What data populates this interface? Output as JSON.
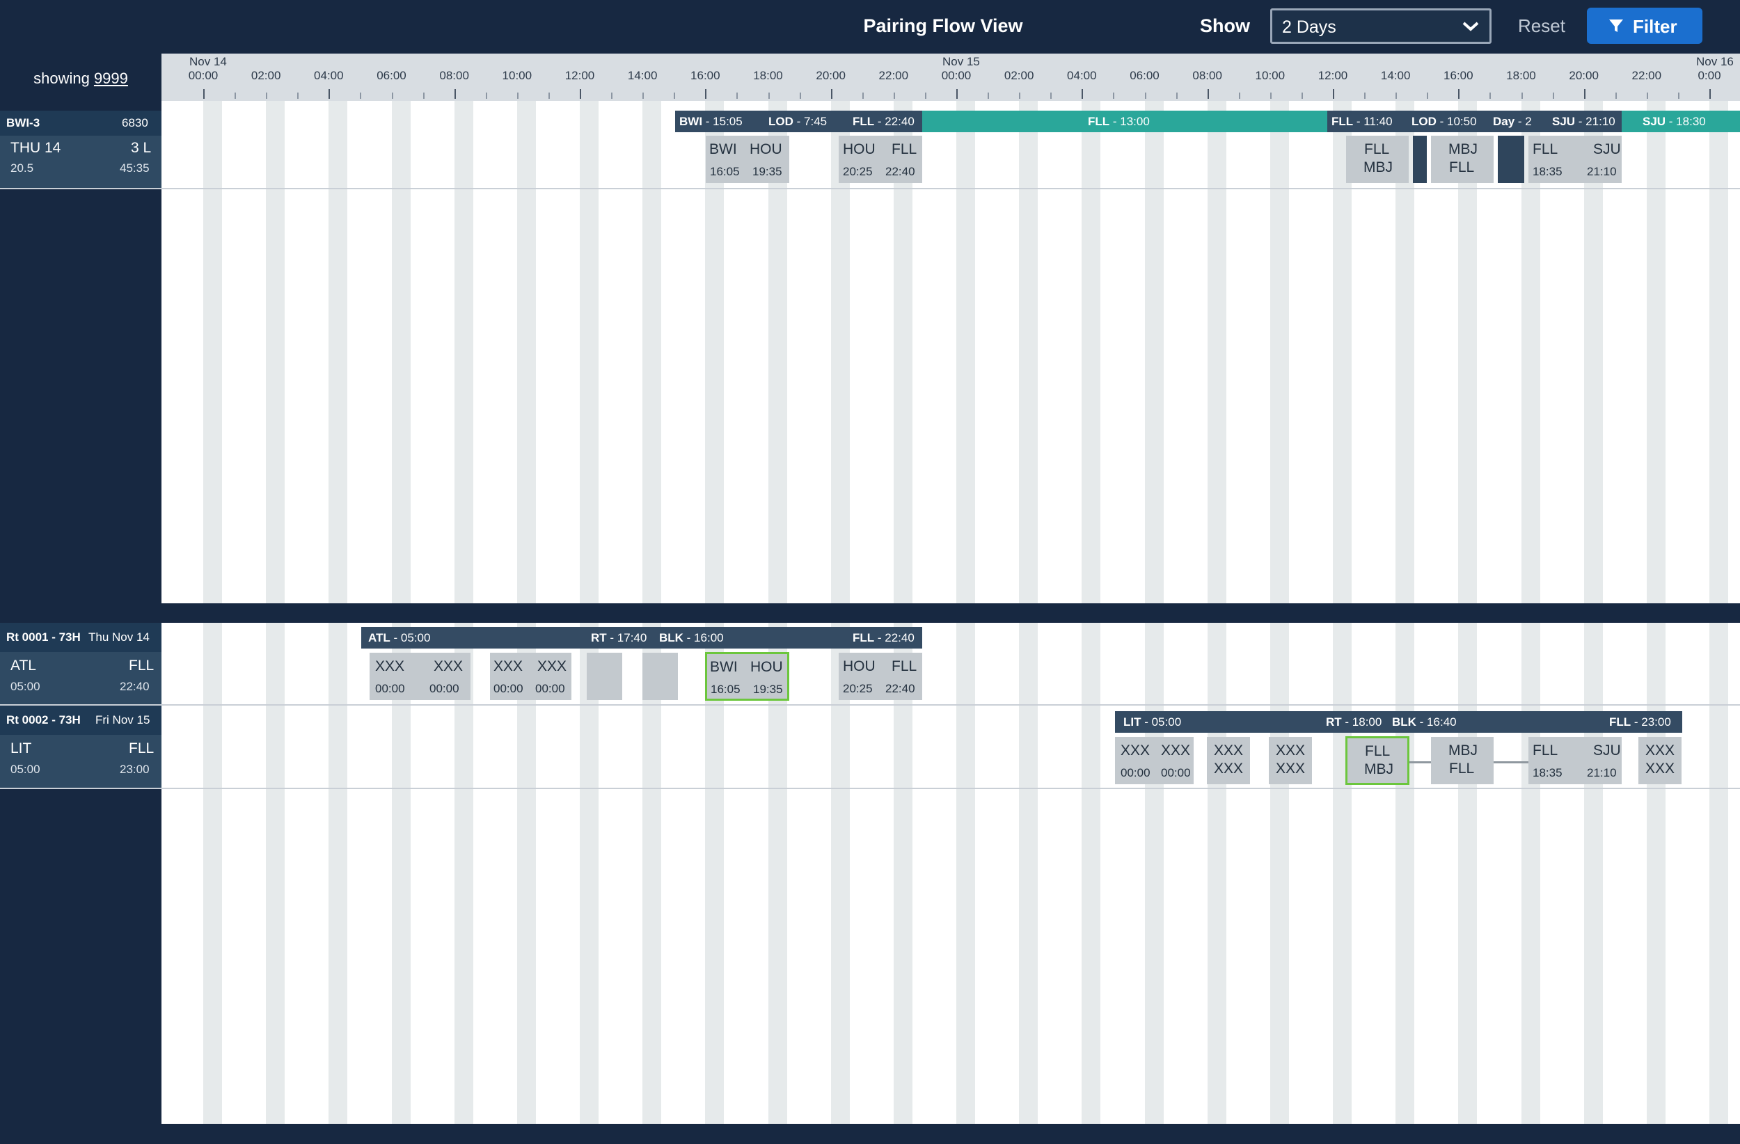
{
  "header": {
    "title": "Pairing Flow View",
    "show_label": "Show",
    "show_select": "2 Days",
    "reset_label": "Reset",
    "filter_label": "Filter"
  },
  "showing": {
    "prefix": "showing",
    "count": "9999"
  },
  "timeline": {
    "dates": [
      "Nov 14",
      "Nov 15",
      "Nov 16"
    ],
    "ticks_day1": [
      "00:00",
      "02:00",
      "04:00",
      "06:00",
      "08:00",
      "10:00",
      "12:00",
      "14:00",
      "16:00",
      "18:00",
      "20:00",
      "22:00"
    ],
    "ticks_day2": [
      "00:00",
      "02:00",
      "04:00",
      "06:00",
      "08:00",
      "10:00",
      "12:00",
      "14:00",
      "16:00",
      "18:00",
      "20:00",
      "22:00"
    ],
    "tick_end": "0:00"
  },
  "pairing": {
    "id": "BWI-3",
    "number": "6830",
    "day": "THU 14",
    "legs": "3 L",
    "credit": "20.5",
    "tafb": "45:35",
    "bar": {
      "bwi": "BWI",
      "bwi_t": " - 15:05",
      "lod": "LOD",
      "lod_t": " - 7:45",
      "fll": "FLL",
      "fll_t": " - 22:40",
      "fll_rest": "FLL",
      "fll_rest_t": " - 13:00",
      "fll2": "FLL",
      "fll2_t": " - 11:40",
      "lod2": "LOD",
      "lod2_t": " - 10:50",
      "day": "Day",
      "day_t": " - 2",
      "sju": "SJU",
      "sju_t": " - 21:10",
      "sju_rest": "SJU",
      "sju_rest_t": " - 18:30"
    },
    "flights": [
      {
        "from": "BWI",
        "to": "HOU",
        "dep": "16:05",
        "arr": "19:35"
      },
      {
        "from": "HOU",
        "to": "FLL",
        "dep": "20:25",
        "arr": "22:40"
      },
      {
        "from": "FLL",
        "to": "MBJ"
      },
      {
        "from": "MBJ",
        "to": "FLL"
      },
      {
        "from": "FLL",
        "to": "SJU",
        "dep": "18:35",
        "arr": "21:10"
      }
    ]
  },
  "routes": [
    {
      "id": "Rt 0001 - 73H",
      "date": "Thu Nov 14",
      "from": "ATL",
      "to": "FLL",
      "start": "05:00",
      "end": "22:40",
      "bar": {
        "a": "ATL",
        "a_t": " - 05:00",
        "rt": "RT",
        "rt_t": " - 17:40",
        "blk": "BLK",
        "blk_t": " - 16:00",
        "f": "FLL",
        "f_t": " - 22:40"
      },
      "blocks": [
        {
          "from": "XXX",
          "to": "XXX",
          "dep": "00:00",
          "arr": "00:00"
        },
        {
          "from": "XXX",
          "to": "XXX",
          "dep": "00:00",
          "arr": "00:00"
        },
        {
          "from": "BWI",
          "to": "HOU",
          "dep": "16:05",
          "arr": "19:35"
        },
        {
          "from": "HOU",
          "to": "FLL",
          "dep": "20:25",
          "arr": "22:40"
        }
      ]
    },
    {
      "id": "Rt 0002 - 73H",
      "date": "Fri Nov 15",
      "from": "LIT",
      "to": "FLL",
      "start": "05:00",
      "end": "23:00",
      "bar": {
        "a": "LIT",
        "a_t": " - 05:00",
        "rt": "RT",
        "rt_t": " - 18:00",
        "blk": "BLK",
        "blk_t": " - 16:40",
        "f": "FLL",
        "f_t": " - 23:00"
      },
      "blocks": [
        {
          "from": "XXX",
          "to": "XXX",
          "dep": "00:00",
          "arr": "00:00"
        },
        {
          "from": "XXX",
          "to": "XXX"
        },
        {
          "from": "XXX",
          "to": "XXX"
        },
        {
          "from": "FLL",
          "to": "MBJ"
        },
        {
          "from": "MBJ",
          "to": "FLL"
        },
        {
          "from": "FLL",
          "to": "SJU",
          "dep": "18:35",
          "arr": "21:10"
        },
        {
          "from": "XXX",
          "to": "XXX"
        }
      ]
    }
  ],
  "colors": {
    "accent": "#1b6fcf",
    "teal": "#2aa79a",
    "selected": "#6cc63d",
    "navy": "#172841"
  }
}
